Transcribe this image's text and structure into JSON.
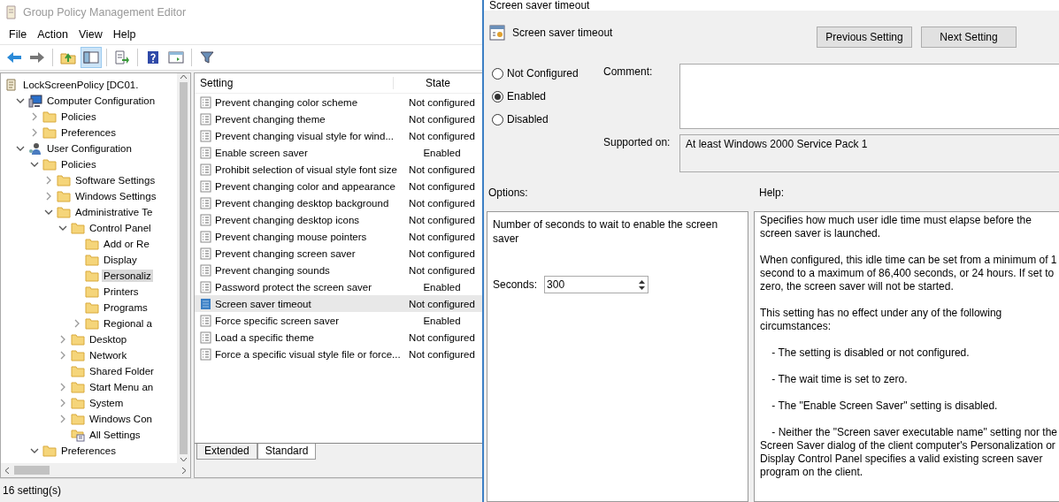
{
  "window": {
    "title": "Group Policy Management Editor"
  },
  "menu": [
    "File",
    "Action",
    "View",
    "Help"
  ],
  "toolbar": [
    {
      "kind": "back"
    },
    {
      "kind": "forward"
    },
    {
      "kind": "sep"
    },
    {
      "kind": "up"
    },
    {
      "kind": "tree",
      "pressed": true
    },
    {
      "kind": "sep"
    },
    {
      "kind": "export"
    },
    {
      "kind": "sep"
    },
    {
      "kind": "help"
    },
    {
      "kind": "props"
    },
    {
      "kind": "sep"
    },
    {
      "kind": "filter"
    }
  ],
  "tree": [
    {
      "label": "LockScreenPolicy [DC01.",
      "kind": "policy",
      "selected": false,
      "children": [
        {
          "label": "Computer Configuration",
          "kind": "computer",
          "expanded": true,
          "selected": false,
          "children": [
            {
              "label": "Policies",
              "kind": "folder",
              "expanded": false,
              "selected": false
            },
            {
              "label": "Preferences",
              "kind": "folder",
              "expanded": false,
              "selected": false
            }
          ]
        },
        {
          "label": "User Configuration",
          "kind": "user",
          "expanded": true,
          "selected": false,
          "children": [
            {
              "label": "Policies",
              "kind": "folder",
              "expanded": true,
              "selected": false,
              "children": [
                {
                  "label": "Software Settings",
                  "kind": "folder",
                  "expanded": false,
                  "selected": false
                },
                {
                  "label": "Windows Settings",
                  "kind": "folder",
                  "expanded": false,
                  "selected": false
                },
                {
                  "label": "Administrative Te",
                  "kind": "folder",
                  "expanded": true,
                  "selected": false,
                  "children": [
                    {
                      "label": "Control Panel",
                      "kind": "folder",
                      "expanded": true,
                      "selected": false,
                      "children": [
                        {
                          "label": "Add or Re",
                          "kind": "folder",
                          "selected": false
                        },
                        {
                          "label": "Display",
                          "kind": "folder",
                          "selected": false
                        },
                        {
                          "label": "Personaliz",
                          "kind": "folder",
                          "selected": true
                        },
                        {
                          "label": "Printers",
                          "kind": "folder",
                          "selected": false
                        },
                        {
                          "label": "Programs",
                          "kind": "folder",
                          "selected": false
                        },
                        {
                          "label": "Regional a",
                          "kind": "folder",
                          "expanded": false,
                          "selected": false
                        }
                      ]
                    },
                    {
                      "label": "Desktop",
                      "kind": "folder",
                      "expanded": false,
                      "selected": false
                    },
                    {
                      "label": "Network",
                      "kind": "folder",
                      "expanded": false,
                      "selected": false
                    },
                    {
                      "label": "Shared Folder",
                      "kind": "folder",
                      "selected": false
                    },
                    {
                      "label": "Start Menu an",
                      "kind": "folder",
                      "expanded": false,
                      "selected": false
                    },
                    {
                      "label": "System",
                      "kind": "folder",
                      "expanded": false,
                      "selected": false
                    },
                    {
                      "label": "Windows Con",
                      "kind": "folder",
                      "expanded": false,
                      "selected": false
                    },
                    {
                      "label": "All Settings",
                      "kind": "allsettings",
                      "selected": false
                    }
                  ]
                }
              ]
            },
            {
              "label": "Preferences",
              "kind": "folder",
              "expanded": true,
              "selected": false
            }
          ]
        }
      ]
    }
  ],
  "settings": {
    "columns": [
      "Setting",
      "State"
    ],
    "rows": [
      {
        "name": "Prevent changing color scheme",
        "state": "Not configured",
        "selected": false
      },
      {
        "name": "Prevent changing theme",
        "state": "Not configured",
        "selected": false
      },
      {
        "name": "Prevent changing visual style for wind...",
        "state": "Not configured",
        "selected": false
      },
      {
        "name": "Enable screen saver",
        "state": "Enabled",
        "selected": false
      },
      {
        "name": "Prohibit selection of visual style font size",
        "state": "Not configured",
        "selected": false
      },
      {
        "name": "Prevent changing color and appearance",
        "state": "Not configured",
        "selected": false
      },
      {
        "name": "Prevent changing desktop background",
        "state": "Not configured",
        "selected": false
      },
      {
        "name": "Prevent changing desktop icons",
        "state": "Not configured",
        "selected": false
      },
      {
        "name": "Prevent changing mouse pointers",
        "state": "Not configured",
        "selected": false
      },
      {
        "name": "Prevent changing screen saver",
        "state": "Not configured",
        "selected": false
      },
      {
        "name": "Prevent changing sounds",
        "state": "Not configured",
        "selected": false
      },
      {
        "name": "Password protect the screen saver",
        "state": "Enabled",
        "selected": false
      },
      {
        "name": "Screen saver timeout",
        "state": "Not configured",
        "selected": true
      },
      {
        "name": "Force specific screen saver",
        "state": "Enabled",
        "selected": false
      },
      {
        "name": "Load a specific theme",
        "state": "Not configured",
        "selected": false
      },
      {
        "name": "Force a specific visual style file or force...",
        "state": "Not configured",
        "selected": false
      }
    ]
  },
  "view_tabs": [
    {
      "label": "Extended",
      "selected": false
    },
    {
      "label": "Standard",
      "selected": true
    }
  ],
  "status_bar": "16 setting(s)",
  "dialog": {
    "title": "Screen saver timeout",
    "setting_name": "Screen saver timeout",
    "buttons": [
      "Previous Setting",
      "Next Setting"
    ],
    "options": [
      {
        "label": "Not Configured",
        "selected": false
      },
      {
        "label": "Enabled",
        "selected": true
      },
      {
        "label": "Disabled",
        "selected": false
      }
    ],
    "comment_label": "Comment:",
    "supported_label": "Supported on:",
    "supported_value": "At least Windows 2000 Service Pack 1",
    "options_label": "Options:",
    "help_label": "Help:",
    "option_text": "Number of seconds to wait to enable the screen saver",
    "seconds_label": "Seconds:",
    "seconds_value": "300",
    "help": [
      "Specifies how much user idle time must elapse before the screen saver is launched.",
      "When configured, this idle time can be set from a minimum of 1 second to a maximum of 86,400 seconds, or 24 hours. If set to zero, the screen saver will not be started.",
      "This setting has no effect under any of the following circumstances:",
      "    - The setting is disabled or not configured.",
      "    - The wait time is set to zero.",
      "    - The \"Enable Screen Saver\" setting is disabled.",
      "    - Neither the \"Screen saver executable name\" setting nor the Screen Saver dialog of the client computer's Personalization or Display Control Panel specifies a valid existing screen saver program on the client."
    ]
  }
}
